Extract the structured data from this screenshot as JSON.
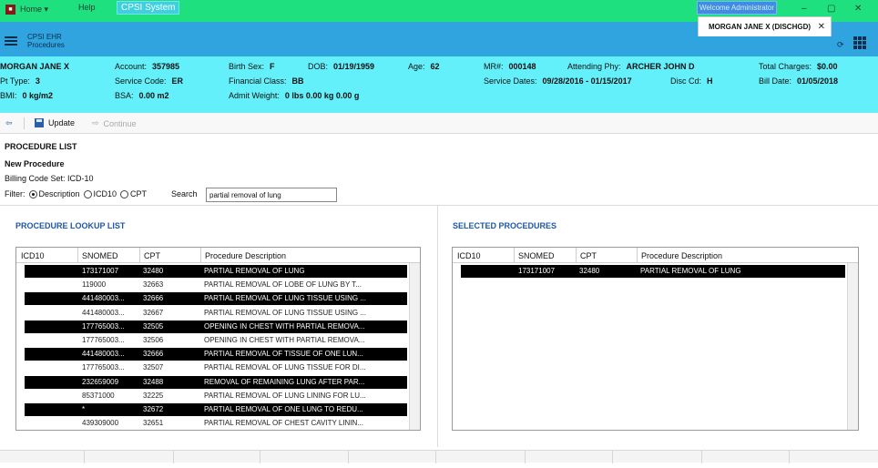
{
  "menu": {
    "home_label": "Home ▾",
    "help_label": "Help",
    "system_label": "CPSI System",
    "user_label": "Welcome Administrator",
    "window_buttons": [
      "–",
      "▢",
      "✕"
    ]
  },
  "header": {
    "title_line1": "CPSI EHR",
    "title_line2": "Procedures",
    "patient_tab_label": "MORGAN JANE X (DISCHGD)",
    "patient_tab_close": "✕",
    "refresh_glyph": "⟳"
  },
  "banner": {
    "name": "MORGAN JANE X",
    "pt_type_label": "Pt Type:",
    "pt_type": "3",
    "bmi_label": "BMI:",
    "bmi": "0 kg/m2",
    "account_label": "Account:",
    "account": "357985",
    "service_code_label": "Service Code:",
    "service_code": "ER",
    "bsa_label": "BSA:",
    "bsa": "0.00 m2",
    "birth_sex_label": "Birth Sex:",
    "birth_sex": "F",
    "financial_class_label": "Financial Class:",
    "financial_class": "BB",
    "admit_weight_label": "Admit Weight:",
    "admit_weight": "0 lbs 0.00 kg 0.00 g",
    "dob_label": "DOB:",
    "dob": "01/19/1959",
    "age_label": "Age:",
    "age": "62",
    "mr_label": "MR#:",
    "mr": "000148",
    "service_dates_label": "Service Dates:",
    "service_dates": "09/28/2016 - 01/15/2017",
    "attending_label": "Attending Phy:",
    "attending": "ARCHER JOHN D",
    "disc_cd_label": "Disc Cd:",
    "disc_cd": "H",
    "total_charges_label": "Total Charges:",
    "total_charges": "$0.00",
    "bill_date_label": "Bill Date:",
    "bill_date": "01/05/2018"
  },
  "toolbar": {
    "back_glyph": "⇦",
    "update_label": "Update",
    "continue_glyph": "⇨",
    "continue_label": "Continue"
  },
  "form": {
    "section_title": "PROCEDURE LIST",
    "new_procedure": "New Procedure",
    "billing_code_set": "Billing Code Set:  ICD-10",
    "filter_label": "Filter:",
    "filter_options": [
      "Description",
      "ICD10",
      "CPT"
    ],
    "filter_selected": "Description",
    "search_label": "Search",
    "search_value": "partial removal of lung"
  },
  "lookup": {
    "title": "PROCEDURE LOOKUP LIST",
    "columns": [
      "ICD10",
      "SNOMED",
      "CPT",
      "Procedure Description"
    ],
    "rows": [
      {
        "icd10": "",
        "snomed": "173171007",
        "cpt": "32480",
        "desc": "PARTIAL REMOVAL OF LUNG",
        "selected": true
      },
      {
        "icd10": "",
        "snomed": "119000",
        "cpt": "32663",
        "desc": "PARTIAL REMOVAL OF LOBE OF LUNG BY T...",
        "selected": false
      },
      {
        "icd10": "",
        "snomed": "441480003...",
        "cpt": "32666",
        "desc": "PARTIAL REMOVAL OF LUNG TISSUE USING ...",
        "selected": true
      },
      {
        "icd10": "",
        "snomed": "441480003...",
        "cpt": "32667",
        "desc": "PARTIAL REMOVAL OF LUNG TISSUE USING ...",
        "selected": false
      },
      {
        "icd10": "",
        "snomed": "177765003...",
        "cpt": "32505",
        "desc": "OPENING IN CHEST WITH PARTIAL REMOVA...",
        "selected": true
      },
      {
        "icd10": "",
        "snomed": "177765003...",
        "cpt": "32506",
        "desc": "OPENING IN CHEST WITH PARTIAL REMOVA...",
        "selected": false
      },
      {
        "icd10": "",
        "snomed": "441480003...",
        "cpt": "32666",
        "desc": "PARTIAL REMOVAL OF TISSUE OF ONE LUN...",
        "selected": true
      },
      {
        "icd10": "",
        "snomed": "177765003...",
        "cpt": "32507",
        "desc": "PARTIAL REMOVAL OF LUNG TISSUE FOR DI...",
        "selected": false
      },
      {
        "icd10": "",
        "snomed": "232659009",
        "cpt": "32488",
        "desc": "REMOVAL OF REMAINING LUNG AFTER PAR...",
        "selected": true
      },
      {
        "icd10": "",
        "snomed": "85371000",
        "cpt": "32225",
        "desc": "PARTIAL REMOVAL OF LUNG LINING FOR LU...",
        "selected": false
      },
      {
        "icd10": "",
        "snomed": "*",
        "cpt": "32672",
        "desc": "PARTIAL REMOVAL OF ONE LUNG TO REDU...",
        "selected": true
      },
      {
        "icd10": "",
        "snomed": "439309000",
        "cpt": "32651",
        "desc": "PARTIAL REMOVAL OF CHEST CAVITY LININ...",
        "selected": false
      }
    ]
  },
  "selected": {
    "title": "SELECTED PROCEDURES",
    "columns": [
      "ICD10",
      "SNOMED",
      "CPT",
      "Procedure Description"
    ],
    "rows": [
      {
        "icd10": "",
        "snomed": "173171007",
        "cpt": "32480",
        "desc": "PARTIAL REMOVAL OF LUNG",
        "selected": true
      }
    ]
  }
}
